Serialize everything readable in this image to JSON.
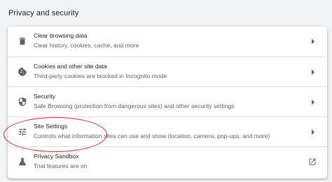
{
  "section": {
    "title": "Privacy and security"
  },
  "rows": [
    {
      "label": "Clear browsing data",
      "sublabel": "Clear history, cookies, cache, and more",
      "icon": "trash-icon",
      "action": "chevron"
    },
    {
      "label": "Cookies and other site data",
      "sublabel": "Third-party cookies are blocked in Incognito mode",
      "icon": "cookie-icon",
      "action": "chevron"
    },
    {
      "label": "Security",
      "sublabel": "Safe Browsing (protection from dangerous sites) and other security settings",
      "icon": "shield-icon",
      "action": "chevron"
    },
    {
      "label": "Site Settings",
      "sublabel": "Controls what information sites can use and show (location, camera, pop-ups, and more)",
      "icon": "tune-icon",
      "action": "chevron"
    },
    {
      "label": "Privacy Sandbox",
      "sublabel": "Trial features are on",
      "icon": "flask-icon",
      "action": "open-in-new"
    }
  ],
  "colors": {
    "background": "#f1f3f4",
    "card": "#ffffff",
    "primary_text": "#202124",
    "secondary_text": "#5f6368",
    "icon": "#5f6368",
    "annotation": "#d8282a"
  }
}
